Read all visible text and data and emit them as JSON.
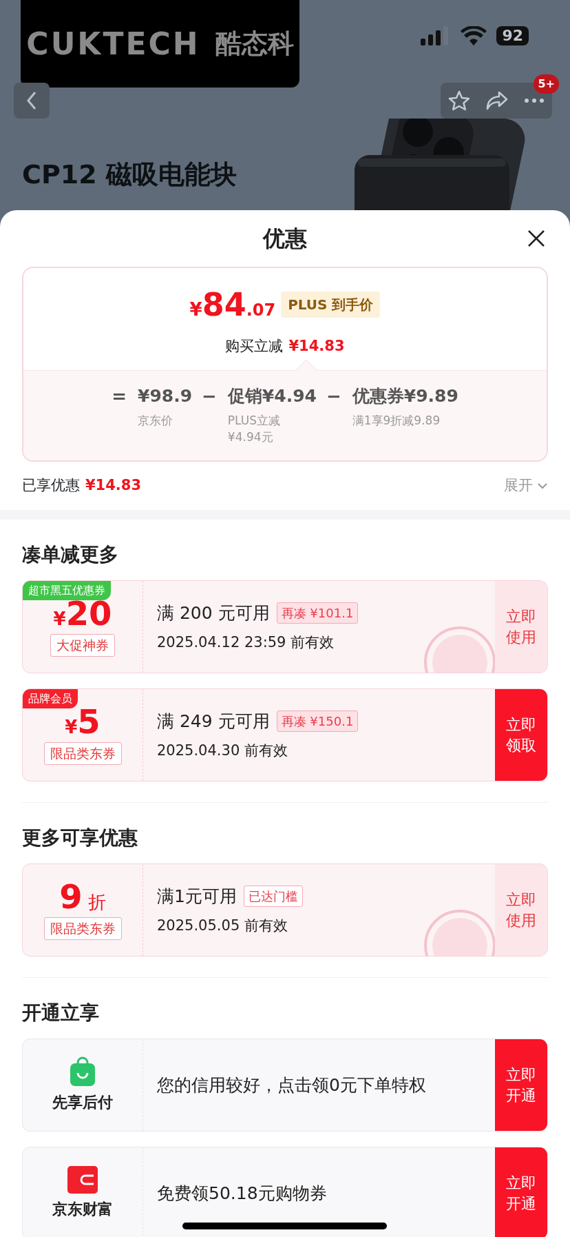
{
  "status_bar": {
    "battery": "92"
  },
  "banner": {
    "logo": {
      "brand": "CUKTECH",
      "brand_cn": "酷态科"
    },
    "badge": "5+",
    "product": {
      "title": "CP12 磁吸电能块"
    }
  },
  "sheet": {
    "title": "优惠"
  },
  "price": {
    "currency": "¥",
    "integer": "84",
    "decimal": ".07",
    "label": "PLUS 到手价",
    "discount_label": "购买立减",
    "discount": "¥14.83",
    "formula": [
      {
        "op": "=",
        "text": "¥98.9",
        "note": [
          "京东价"
        ]
      },
      {
        "op": "−",
        "text": "促销¥4.94",
        "note": [
          "PLUS立减",
          "¥4.94元"
        ]
      },
      {
        "op": "−",
        "text": "优惠券¥9.89",
        "note": [
          "满1享9折减9.89"
        ]
      }
    ]
  },
  "summary": {
    "label": "已享优惠",
    "amount": "¥14.83",
    "expand": "展开"
  },
  "sections": [
    {
      "title": "凑单减更多",
      "items": [
        {
          "kind": "coupon",
          "tag": {
            "text": "超市黑五优惠券",
            "color": "#3fc548"
          },
          "value": {
            "kind": "cash",
            "currency": "¥",
            "amount": "20"
          },
          "label": "大促神券",
          "condition": "满 200 元可用",
          "hint": "再凑 ¥101.1",
          "reached": false,
          "valid": "2025.04.12 23:59 前有效",
          "button": "立即使用",
          "claimed": true
        },
        {
          "kind": "coupon",
          "tag": {
            "text": "品牌会员",
            "color": "#f5222d"
          },
          "value": {
            "kind": "cash",
            "currency": "¥",
            "amount": "5"
          },
          "label": "限品类东券",
          "condition": "满 249 元可用",
          "hint": "再凑 ¥150.1",
          "reached": false,
          "valid": "2025.04.30 前有效",
          "button": "立即领取",
          "claimed": false
        }
      ]
    },
    {
      "title": "更多可享优惠",
      "items": [
        {
          "kind": "coupon",
          "value": {
            "kind": "discount",
            "amount": "9",
            "unit": "折"
          },
          "label": "限品类东券",
          "condition": "满1元可用",
          "hint": "已达门槛",
          "reached": true,
          "valid": "2025.05.05 前有效",
          "button": "立即使用",
          "claimed": true
        }
      ]
    },
    {
      "title": "开通立享",
      "items": [
        {
          "kind": "service",
          "name": "先享后付",
          "text": "您的信用较好，点击领0元下单特权",
          "button": "立即开通"
        },
        {
          "kind": "service",
          "name": "京东财富",
          "text": "免费领50.18元购物券",
          "button": "立即开通"
        }
      ]
    }
  ]
}
